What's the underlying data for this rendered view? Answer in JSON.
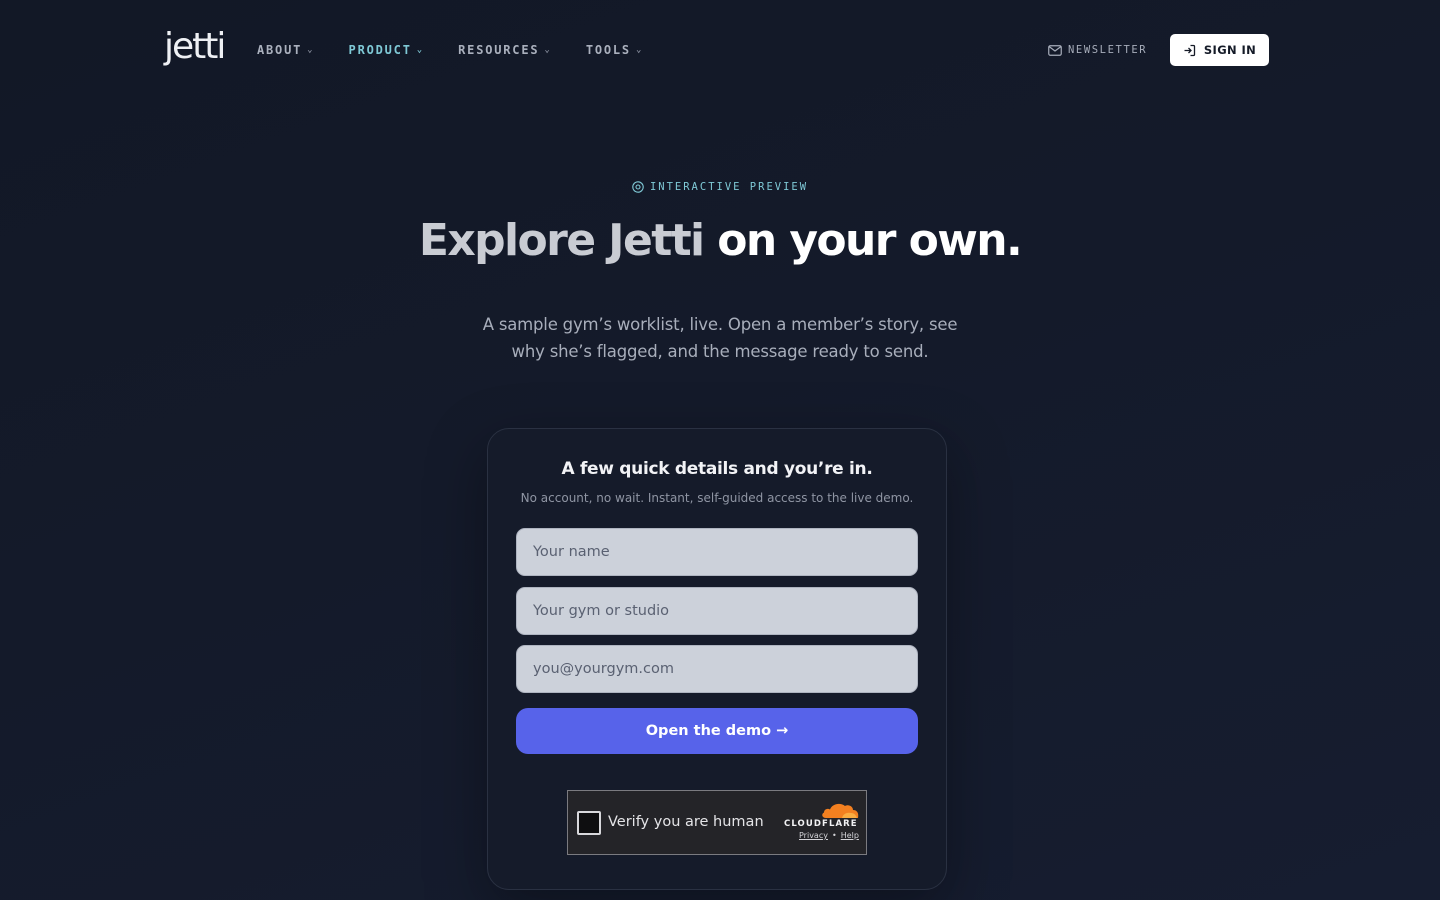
{
  "header": {
    "logo": "jetti",
    "nav": [
      {
        "label": "ABOUT"
      },
      {
        "label": "PRODUCT"
      },
      {
        "label": "RESOURCES"
      },
      {
        "label": "TOOLS"
      }
    ],
    "active_nav": "PRODUCT",
    "newsletter_label": "NEWSLETTER",
    "signin_label": "SIGN IN"
  },
  "hero": {
    "eyebrow": "INTERACTIVE PREVIEW",
    "headline_muted": "Explore Jetti",
    "headline_bright": "on your own.",
    "subtext": "A sample gym’s worklist, live. Open a member’s story, see why she’s flagged, and the message ready to send."
  },
  "form": {
    "title": "A few quick details and you’re in.",
    "subtitle": "No account, no wait. Instant, self-guided access to the live demo.",
    "name_placeholder": "Your name",
    "name_value": "",
    "gym_placeholder": "Your gym or studio",
    "gym_value": "",
    "email_placeholder": "you@yourgym.com",
    "email_value": "",
    "submit_label": "Open the demo →"
  },
  "captcha": {
    "label": "Verify you are human",
    "brand": "CLOUDFLARE",
    "privacy": "Privacy",
    "separator": "•",
    "help": "Help"
  },
  "colors": {
    "accent": "#5763ea",
    "nav_active": "#7fc9d6",
    "cloudflare_orange": "#f38020"
  },
  "icons": {
    "chevron": "chevron-down-icon",
    "newsletter": "mail-icon",
    "signin": "sign-in-arrow-icon",
    "eyebrow": "play-circle-icon",
    "cloudflare": "cloudflare-cloud-icon"
  }
}
